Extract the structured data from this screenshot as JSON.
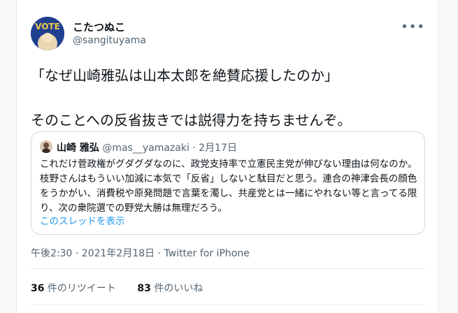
{
  "tweet": {
    "author": {
      "display_name": "こたつぬこ",
      "handle": "@sangituyama",
      "avatar_text": "VOTE"
    },
    "more_icon": "more-dots-icon",
    "text": "「なぜ山崎雅弘は山本太郎を絶賛応援したのか」\n\nそのことへの反省抜きでは説得力を持ちませんぞ。",
    "quote": {
      "name": "山崎 雅弘",
      "handle": "@mas__yamazaki",
      "date": "2月17日",
      "separator": " · ",
      "body": "これだけ菅政権がグダグダなのに、政党支持率で立憲民主党が伸びない理由は何なのか。枝野さんはもういい加減に本気で「反省」しないと駄目だと思う。連合の神津会長の顔色をうかがい、消費税や原発問題で言葉を濁し、共産党とは一緒にやれない等と言ってる限り、次の衆院選での野党大勝は無理だろう。",
      "thread_link": "このスレッドを表示"
    },
    "meta": "午後2:30 · 2021年2月18日 · Twitter for iPhone",
    "stats": {
      "retweets_count": "36",
      "retweets_label": "件のリツイート",
      "likes_count": "83",
      "likes_label": "件のいいね"
    }
  },
  "colors": {
    "link": "#1d9bf0",
    "secondary": "#536471",
    "border": "#cfd9de"
  }
}
